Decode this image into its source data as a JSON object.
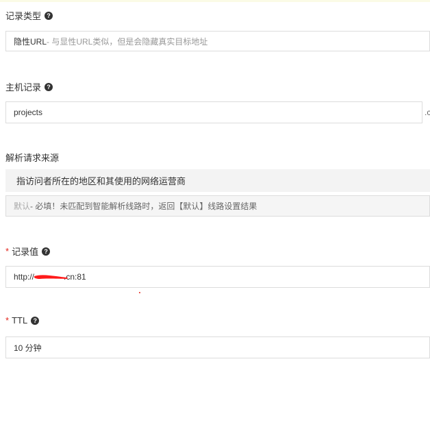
{
  "record_type": {
    "label": "记录类型",
    "value_main": "隐性URL",
    "value_desc": "- 与显性URL类似，但是会隐藏真实目标地址"
  },
  "host_record": {
    "label": "主机记录",
    "value": "projects",
    "suffix": ".c"
  },
  "resolve_source": {
    "label": "解析请求来源",
    "bar_text": "指访问者所在的地区和其使用的网络运营商",
    "value_main": "默认",
    "value_desc": " - 必填！未匹配到智能解析线路时，返回【默认】线路设置结果"
  },
  "record_value": {
    "required_mark": "*",
    "label": "记录值",
    "value_prefix": "http://",
    "value_suffix": ".cn:81"
  },
  "ttl": {
    "required_mark": "*",
    "label": "TTL",
    "value": "10 分钟"
  },
  "colors": {
    "required": "#e2231a",
    "border": "#dcdcdc",
    "bar_bg": "#f3f3f3"
  }
}
